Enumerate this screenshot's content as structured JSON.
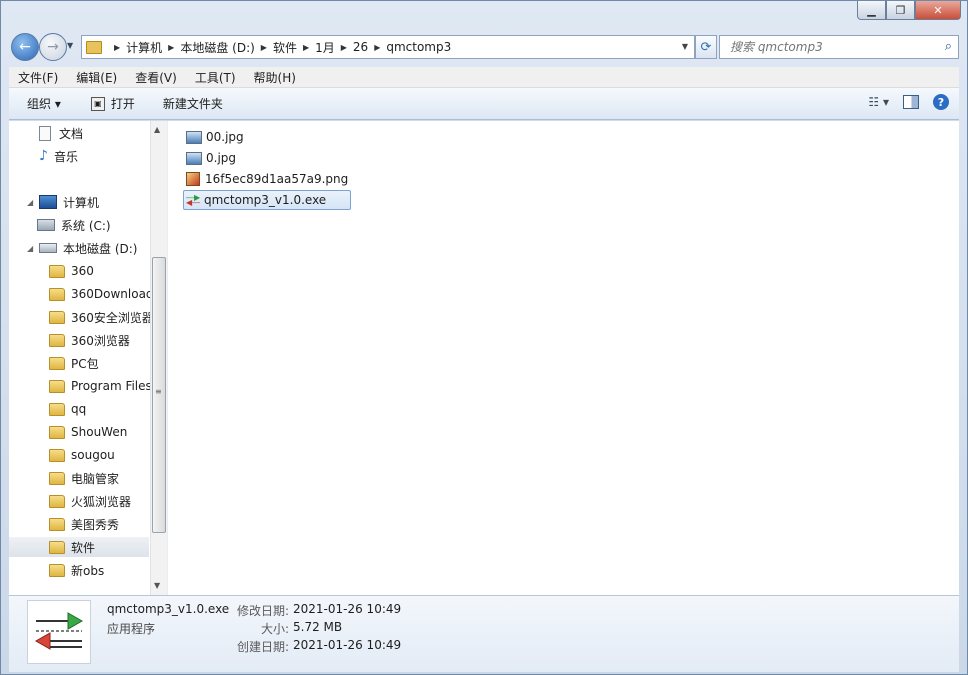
{
  "address": {
    "crumbs": [
      "计算机",
      "本地磁盘 (D:)",
      "软件",
      "1月",
      "26",
      "qmctomp3"
    ]
  },
  "search": {
    "placeholder": "搜索 qmctomp3"
  },
  "menubar": {
    "items": [
      "文件(F)",
      "编辑(E)",
      "查看(V)",
      "工具(T)",
      "帮助(H)"
    ]
  },
  "commandbar": {
    "organize": "组织 ▾",
    "open": "打开",
    "new_folder": "新建文件夹"
  },
  "tree": {
    "docs": "文档",
    "music": "音乐",
    "computer": "计算机",
    "drive_c": "系统 (C:)",
    "drive_d": "本地磁盘 (D:)",
    "folders": [
      "360",
      "360Download",
      "360安全浏览器",
      "360浏览器",
      "PC包",
      "Program Files",
      "qq",
      "ShouWen",
      "sougou",
      "电脑管家",
      "火狐浏览器",
      "美图秀秀",
      "软件",
      "新obs"
    ],
    "selected_folder": "软件"
  },
  "files": [
    {
      "name": "00.jpg",
      "type": "jpg"
    },
    {
      "name": "0.jpg",
      "type": "jpg"
    },
    {
      "name": "16f5ec89d1aa57a9.png",
      "type": "png"
    },
    {
      "name": "qmctomp3_v1.0.exe",
      "type": "exe",
      "selected": true
    }
  ],
  "details": {
    "name": "qmctomp3_v1.0.exe",
    "type": "应用程序",
    "modified_label": "修改日期:",
    "modified": "2021-01-26 10:49",
    "size_label": "大小:",
    "size": "5.72 MB",
    "created_label": "创建日期:",
    "created": "2021-01-26 10:49"
  }
}
